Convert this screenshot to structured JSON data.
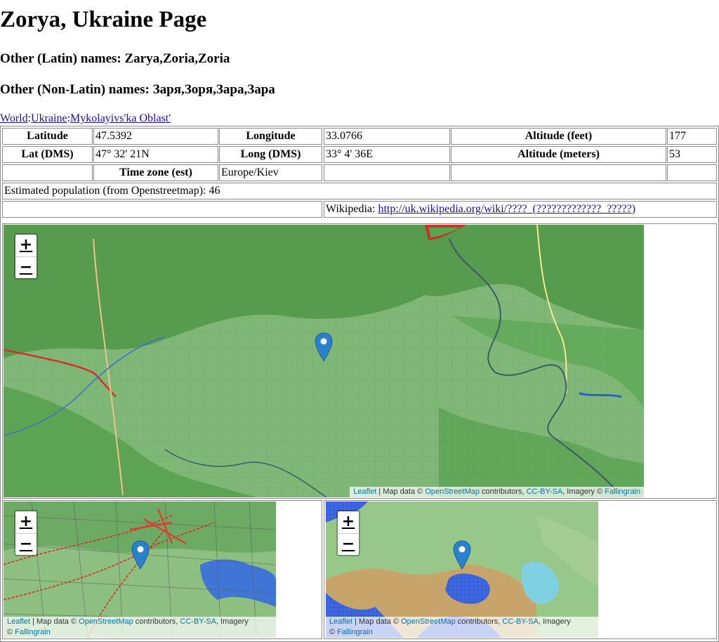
{
  "title": "Zorya, Ukraine Page",
  "latin_names": "Other (Latin) names: Zarya,Zoria,Zoria",
  "nonlatin_names": "Other (Non-Latin) names: Заря,Зоря,Зара,Зара",
  "breadcrumb": {
    "items": [
      "World",
      "Ukraine",
      "Mykolayivs'ka Oblast'"
    ],
    "separator": ":"
  },
  "info": {
    "latitude_label": "Latitude",
    "latitude": "47.5392",
    "longitude_label": "Longitude",
    "longitude": "33.0766",
    "alt_feet_label": "Altitude (feet)",
    "alt_feet": "177",
    "lat_dms_label": "Lat (DMS)",
    "lat_dms": "47° 32' 21N",
    "long_dms_label": "Long (DMS)",
    "long_dms": "33° 4' 36E",
    "alt_m_label": "Altitude (meters)",
    "alt_m": "53",
    "tz_label": "Time zone (est)",
    "tz": "Europe/Kiev",
    "population": "Estimated population (from Openstreetmap): 46",
    "wiki_label": "Wikipedia:",
    "wiki_link": "http://uk.wikipedia.org/wiki/????_(?????????????_?????)"
  },
  "map": {
    "zoom_in": "+",
    "zoom_out": "−",
    "attr": {
      "leaflet": "Leaflet",
      "sep": " | Map data © ",
      "osm": "OpenStreetMap",
      "contrib": " contributors, ",
      "license": "CC-BY-SA",
      "imagery": ", Imagery © ",
      "imagery_short": ", Imagery",
      "copy": "© ",
      "provider": "Fallingrain"
    }
  },
  "colors": {
    "link": "#1a0dab",
    "marker": "#2a81cb",
    "terrain": "#74ad6c",
    "water": "#3a6fd8",
    "road": "#d83a2a",
    "attr_link": "#0078a8"
  },
  "icons": {
    "marker": "map-marker-icon"
  }
}
